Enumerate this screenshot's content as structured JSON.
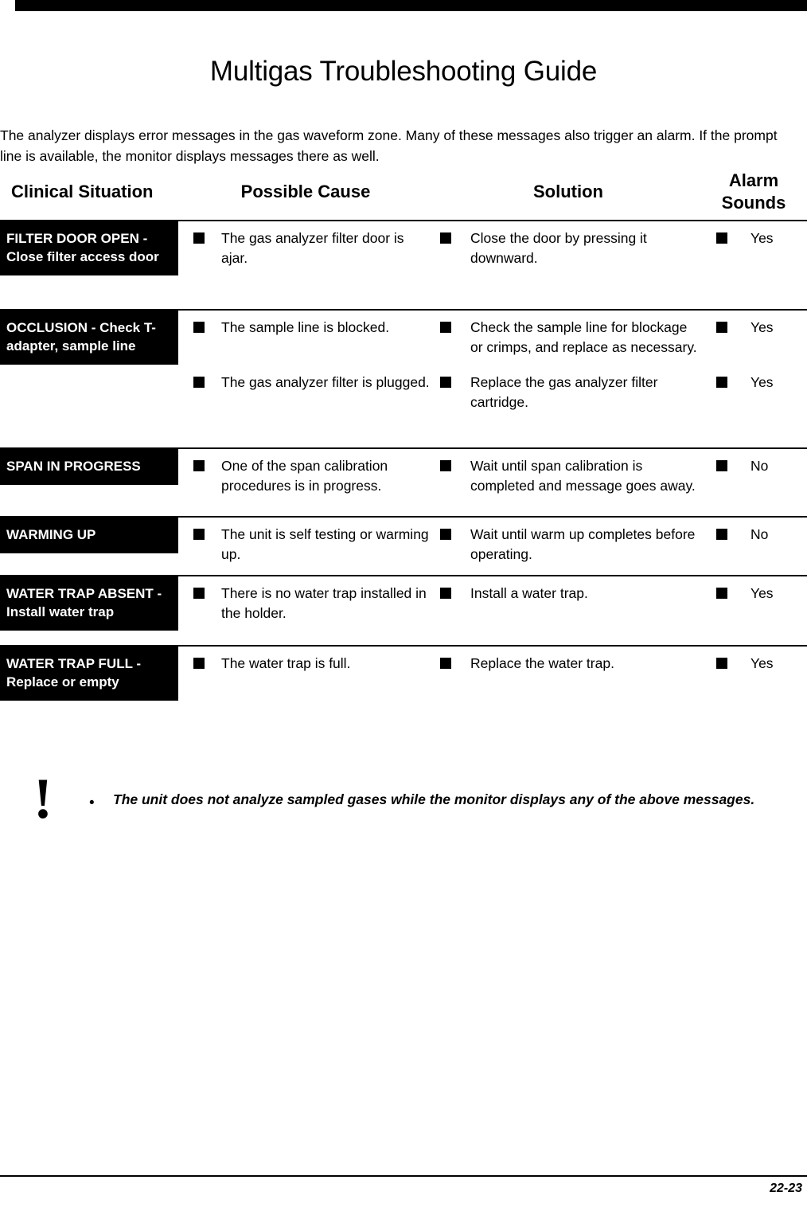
{
  "page": {
    "title": "Multigas Troubleshooting Guide",
    "intro": "The analyzer displays error messages in the gas waveform zone. Many of these messages also trigger an alarm. If the prompt line is available, the monitor displays messages there as well.",
    "footer_page_number": "22-23"
  },
  "table": {
    "headers": {
      "clinical_situation": "Clinical Situation",
      "possible_cause": "Possible Cause",
      "solution": "Solution",
      "alarm_sounds": "Alarm\nSounds",
      "alarm_sounds_line1": "Alarm",
      "alarm_sounds_line2": "Sounds"
    },
    "rows": [
      {
        "situation": "FILTER DOOR OPEN - Close filter access door",
        "entries": [
          {
            "cause": "The gas analyzer filter door is ajar.",
            "solution": "Close the door by pressing it downward.",
            "alarm": "Yes"
          }
        ]
      },
      {
        "situation": "OCCLUSION - Check T-adapter, sample line",
        "entries": [
          {
            "cause": "The sample line is blocked.",
            "solution": "Check the sample line for blockage or crimps, and replace as necessary.",
            "alarm": "Yes"
          },
          {
            "cause": "The gas analyzer filter is plugged.",
            "solution": "Replace the gas analyzer filter cartridge.",
            "alarm": "Yes"
          }
        ]
      },
      {
        "situation": "SPAN IN PROGRESS",
        "entries": [
          {
            "cause": "One of the span calibration procedures is in progress.",
            "solution": "Wait until span calibration is completed and message goes away.",
            "alarm": "No"
          }
        ]
      },
      {
        "situation": "WARMING UP",
        "entries": [
          {
            "cause": "The unit is self testing or warming up.",
            "solution": "Wait until warm up completes before operating.",
            "alarm": "No"
          }
        ]
      },
      {
        "situation": "WATER TRAP ABSENT - Install water trap",
        "entries": [
          {
            "cause": "There is no water trap installed in the holder.",
            "solution": "Install a water trap.",
            "alarm": "Yes"
          }
        ]
      },
      {
        "situation": "WATER TRAP FULL - Replace or empty",
        "entries": [
          {
            "cause": "The water trap is full.",
            "solution": "Replace the water trap.",
            "alarm": "Yes"
          }
        ]
      }
    ]
  },
  "note": {
    "icon": "!",
    "bullet": "•",
    "text": "The unit does not analyze sampled gases while the monitor displays any of the above messages."
  },
  "colors": {
    "ink": "#000000",
    "paper": "#ffffff",
    "reverse_text": "#ffffff"
  }
}
